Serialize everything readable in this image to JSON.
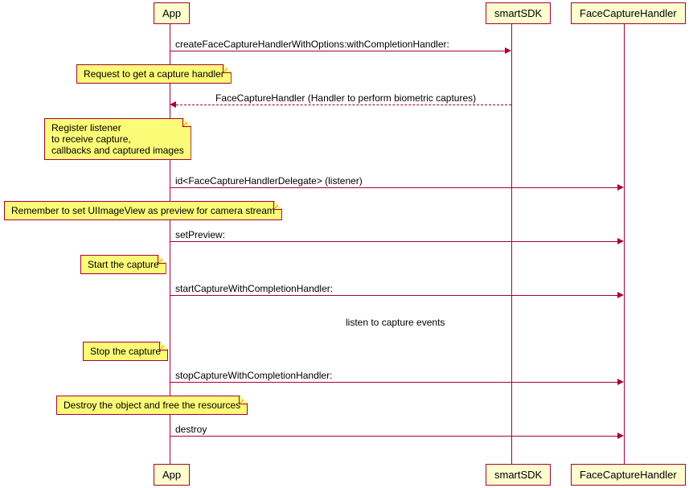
{
  "participants": {
    "app": "App",
    "sdk": "smartSDK",
    "handler": "FaceCaptureHandler"
  },
  "messages": {
    "create": "createFaceCaptureHandlerWithOptions:withCompletionHandler:",
    "handlerReturn": "FaceCaptureHandler (Handler to perform biometric captures)",
    "listener": "id<FaceCaptureHandlerDelegate> (listener)",
    "setPreview": "setPreview:",
    "startCapture": "startCaptureWithCompletionHandler:",
    "divider": "listen to capture events",
    "stopCapture": "stopCaptureWithCompletionHandler:",
    "destroy": "destroy"
  },
  "notes": {
    "requestHandler": "Request to get a capture handler",
    "registerListener": "Register listener\nto receive capture,\ncallbacks and captured images",
    "setPreviewNote": "Remember to set UIImageView as preview for camera stream",
    "startCapture": "Start the capture",
    "stopCapture": "Stop the capture",
    "destroy": "Destroy the object and free the resources"
  },
  "chart_data": {
    "type": "sequence-diagram",
    "participants": [
      "App",
      "smartSDK",
      "FaceCaptureHandler"
    ],
    "interactions": [
      {
        "from": "App",
        "to": "smartSDK",
        "message": "createFaceCaptureHandlerWithOptions:withCompletionHandler:",
        "style": "solid",
        "note_left": "Request to get a capture handler"
      },
      {
        "from": "smartSDK",
        "to": "App",
        "message": "FaceCaptureHandler (Handler to perform biometric captures)",
        "style": "dashed",
        "note_left": "Register listener to receive capture, callbacks and captured images"
      },
      {
        "from": "App",
        "to": "FaceCaptureHandler",
        "message": "id<FaceCaptureHandlerDelegate> (listener)",
        "style": "solid",
        "note_left": "Remember to set UIImageView as preview for camera stream"
      },
      {
        "from": "App",
        "to": "FaceCaptureHandler",
        "message": "setPreview:",
        "style": "solid",
        "note_left": "Start the capture"
      },
      {
        "from": "App",
        "to": "FaceCaptureHandler",
        "message": "startCaptureWithCompletionHandler:",
        "style": "solid"
      },
      {
        "divider": "listen to capture events",
        "note_left": "Stop the capture"
      },
      {
        "from": "App",
        "to": "FaceCaptureHandler",
        "message": "stopCaptureWithCompletionHandler:",
        "style": "solid",
        "note_left": "Destroy the object and free the resources"
      },
      {
        "from": "App",
        "to": "FaceCaptureHandler",
        "message": "destroy",
        "style": "solid"
      }
    ]
  }
}
